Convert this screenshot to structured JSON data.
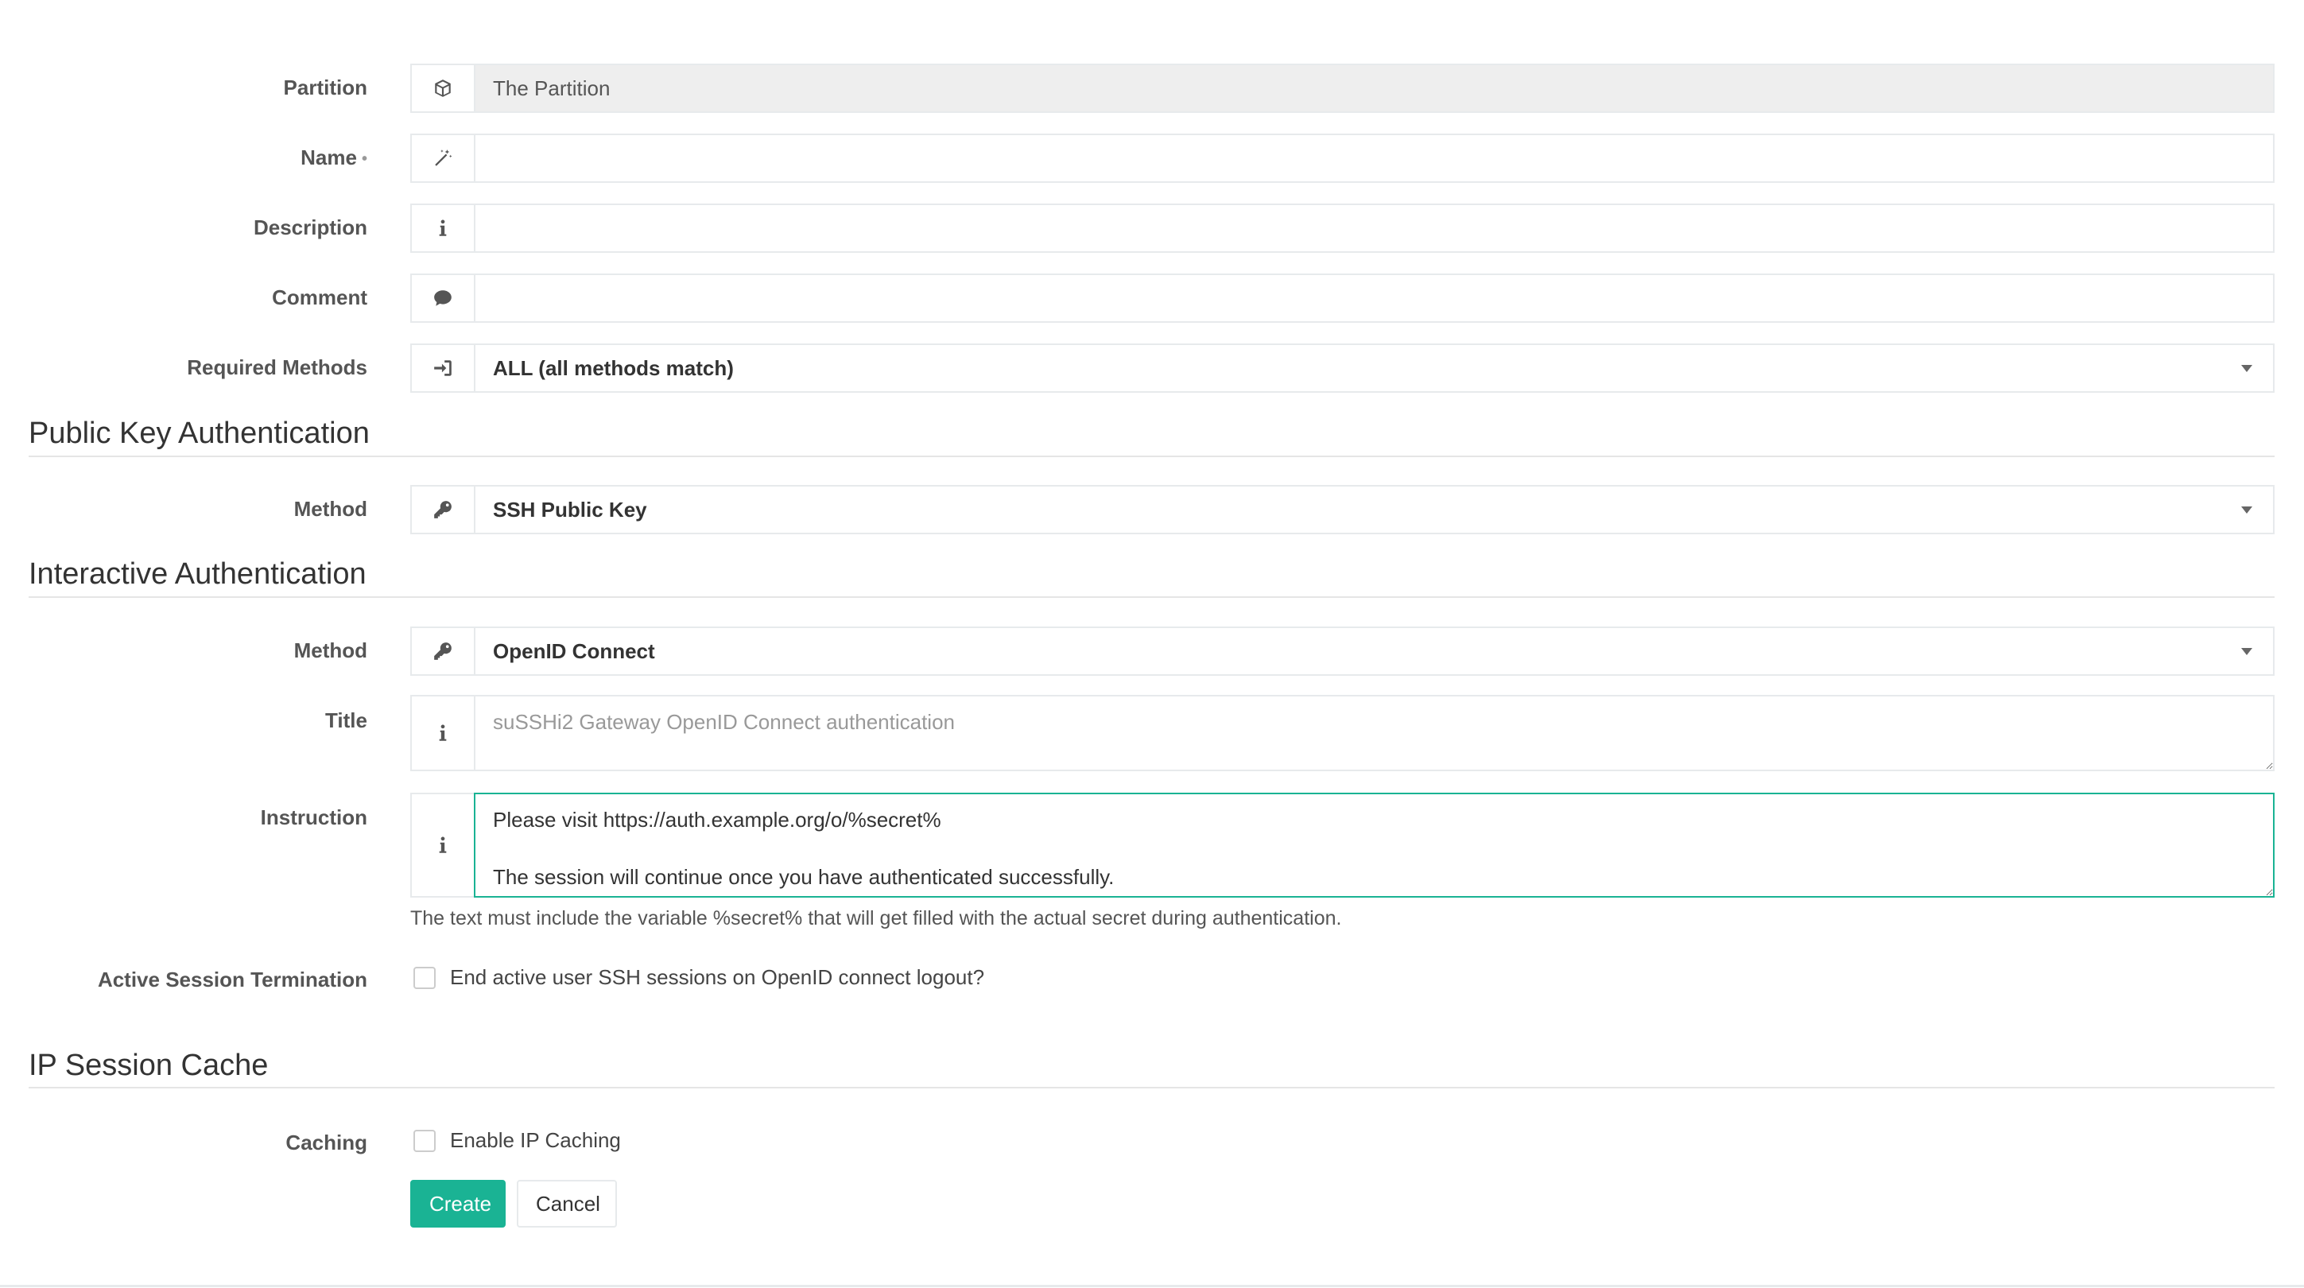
{
  "form": {
    "partition": {
      "label": "Partition",
      "value": "The Partition"
    },
    "name": {
      "label": "Name",
      "required_marker": "•",
      "value": ""
    },
    "description": {
      "label": "Description",
      "value": ""
    },
    "comment": {
      "label": "Comment",
      "value": ""
    },
    "required_methods": {
      "label": "Required Methods",
      "selected": "ALL (all methods match)"
    }
  },
  "public_key_auth": {
    "title": "Public Key Authentication",
    "method": {
      "label": "Method",
      "selected": "SSH Public Key"
    }
  },
  "interactive_auth": {
    "title": "Interactive Authentication",
    "method": {
      "label": "Method",
      "selected": "OpenID Connect"
    },
    "title_field": {
      "label": "Title",
      "value": "",
      "placeholder": "suSSHi2 Gateway OpenID Connect authentication"
    },
    "instruction": {
      "label": "Instruction",
      "value": "Please visit https://auth.example.org/o/%secret%\n\nThe session will continue once you have authenticated successfully.",
      "help": "The text must include the variable %secret% that will get filled with the actual secret during authentication."
    },
    "session_termination": {
      "label": "Active Session Termination",
      "checkbox_label": "End active user SSH sessions on OpenID connect logout?",
      "checked": false
    }
  },
  "ip_session_cache": {
    "title": "IP Session Cache",
    "caching": {
      "label": "Caching",
      "checkbox_label": "Enable IP Caching",
      "checked": false
    }
  },
  "actions": {
    "create_label": "Create",
    "cancel_label": "Cancel"
  },
  "icons": {
    "partition": "cube-icon",
    "name": "magic-wand-icon",
    "description": "info-icon",
    "comment": "comment-icon",
    "required_methods": "sign-in-icon",
    "method": "key-icon",
    "title": "info-icon",
    "instruction": "info-icon"
  },
  "colors": {
    "primary": "#1ab394",
    "border": "#e7eaec",
    "readonly_bg": "#eeeeee"
  }
}
